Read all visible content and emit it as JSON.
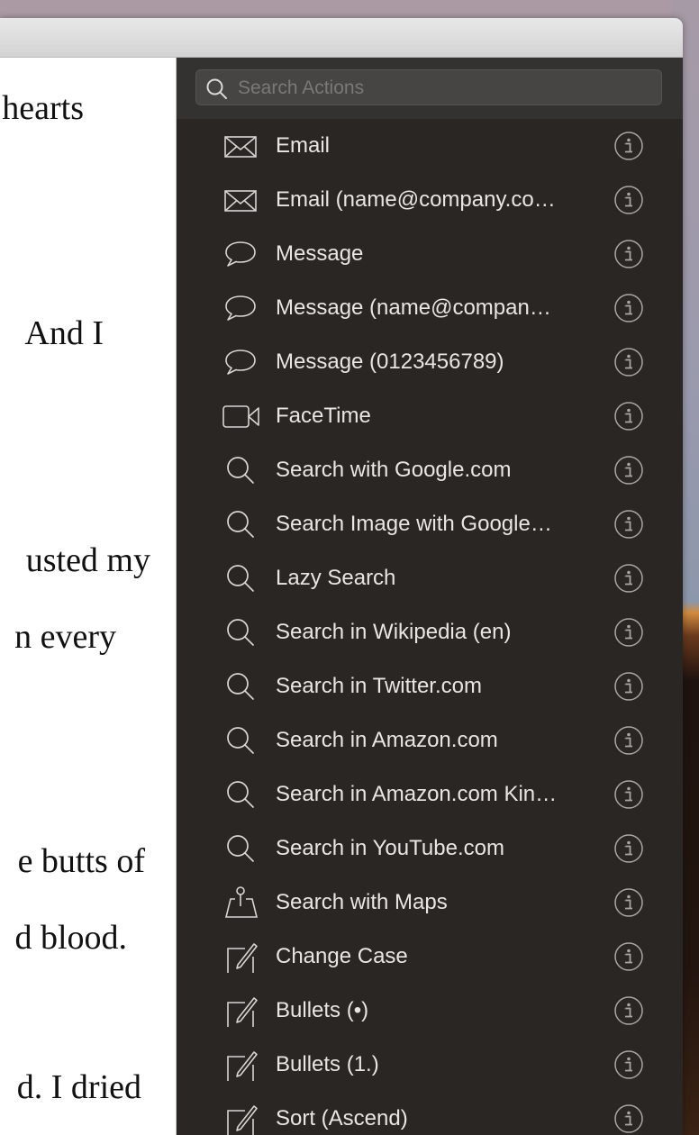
{
  "window": {
    "title": ""
  },
  "document": {
    "visible_line_fragments": [
      "hearts",
      "And I",
      "usted my",
      "n every",
      "e butts of",
      "d blood.",
      "d. I dried"
    ]
  },
  "actions_panel": {
    "search": {
      "placeholder": "Search Actions",
      "value": ""
    },
    "items": [
      {
        "label": "Email",
        "icon": "envelope-icon"
      },
      {
        "label": "Email (name@company.co…",
        "icon": "envelope-icon"
      },
      {
        "label": "Message",
        "icon": "speech-bubble-icon"
      },
      {
        "label": "Message (name@compan…",
        "icon": "speech-bubble-icon"
      },
      {
        "label": "Message (0123456789)",
        "icon": "speech-bubble-icon"
      },
      {
        "label": "FaceTime",
        "icon": "video-camera-icon"
      },
      {
        "label": "Search with Google.com",
        "icon": "magnifier-icon"
      },
      {
        "label": "Search Image with Google…",
        "icon": "magnifier-icon"
      },
      {
        "label": "Lazy Search",
        "icon": "magnifier-icon"
      },
      {
        "label": "Search in Wikipedia (en)",
        "icon": "magnifier-icon"
      },
      {
        "label": "Search in Twitter.com",
        "icon": "magnifier-icon"
      },
      {
        "label": "Search in Amazon.com",
        "icon": "magnifier-icon"
      },
      {
        "label": "Search in Amazon.com Kin…",
        "icon": "magnifier-icon"
      },
      {
        "label": "Search in YouTube.com",
        "icon": "magnifier-icon"
      },
      {
        "label": "Search with Maps",
        "icon": "map-pin-icon"
      },
      {
        "label": "Change Case",
        "icon": "edit-text-icon"
      },
      {
        "label": "Bullets (•)",
        "icon": "edit-text-icon"
      },
      {
        "label": "Bullets (1.)",
        "icon": "edit-text-icon"
      },
      {
        "label": "Sort (Ascend)",
        "icon": "edit-text-icon"
      }
    ],
    "info_icon": "info-circle-icon"
  },
  "colors": {
    "panel_bg": "#2a2624",
    "search_area_bg": "#343230",
    "item_text": "#e8e6e3",
    "icon_stroke": "#d8d6d3",
    "info_stroke": "#a9a7a4"
  }
}
